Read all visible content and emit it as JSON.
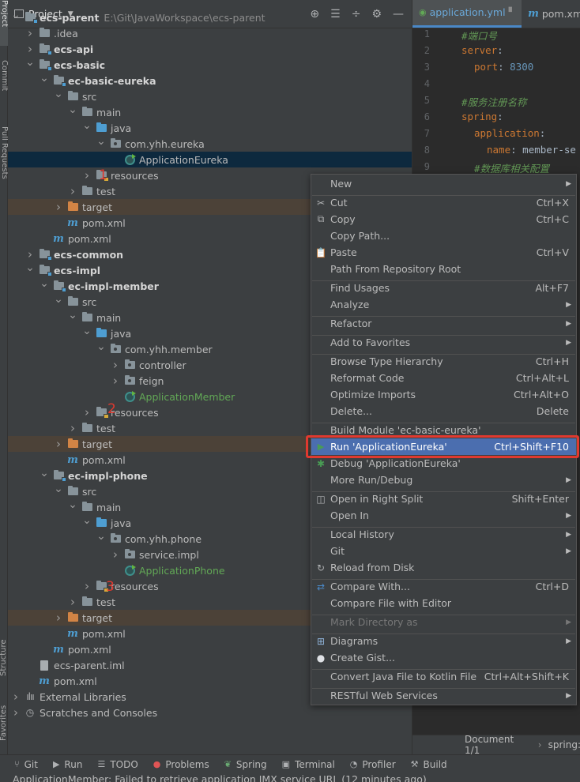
{
  "side_tabs": {
    "project": "Project",
    "commit": "Commit",
    "pull_requests": "Pull Requests",
    "structure": "Structure",
    "favorites": "Favorites"
  },
  "project_panel": {
    "title": "Project",
    "header_icons": [
      "locate-icon",
      "expand-all-icon",
      "collapse-all-icon",
      "gear-icon",
      "hide-icon"
    ],
    "tree": [
      {
        "label": "ecs-parent",
        "path": "E:\\Git\\JavaWorkspace\\ecs-parent",
        "bold": true
      },
      {
        "label": ".idea"
      },
      {
        "label": "ecs-api",
        "bold": true
      },
      {
        "label": "ecs-basic",
        "bold": true
      },
      {
        "label": "ec-basic-eureka",
        "bold": true
      },
      {
        "label": "src"
      },
      {
        "label": "main"
      },
      {
        "label": "java"
      },
      {
        "label": "com.yhh.eureka"
      },
      {
        "label": "ApplicationEureka"
      },
      {
        "label": "resources"
      },
      {
        "label": "test"
      },
      {
        "label": "target"
      },
      {
        "label": "pom.xml"
      },
      {
        "label": "pom.xml"
      },
      {
        "label": "ecs-common",
        "bold": true
      },
      {
        "label": "ecs-impl",
        "bold": true
      },
      {
        "label": "ec-impl-member",
        "bold": true
      },
      {
        "label": "src"
      },
      {
        "label": "main"
      },
      {
        "label": "java"
      },
      {
        "label": "com.yhh.member"
      },
      {
        "label": "controller"
      },
      {
        "label": "feign"
      },
      {
        "label": "ApplicationMember"
      },
      {
        "label": "resources"
      },
      {
        "label": "test"
      },
      {
        "label": "target"
      },
      {
        "label": "pom.xml"
      },
      {
        "label": "ec-impl-phone",
        "bold": true
      },
      {
        "label": "src"
      },
      {
        "label": "main"
      },
      {
        "label": "java"
      },
      {
        "label": "com.yhh.phone"
      },
      {
        "label": "service.impl"
      },
      {
        "label": "ApplicationPhone"
      },
      {
        "label": "resources"
      },
      {
        "label": "test"
      },
      {
        "label": "target"
      },
      {
        "label": "pom.xml"
      },
      {
        "label": "pom.xml"
      },
      {
        "label": "ecs-parent.iml"
      },
      {
        "label": "pom.xml"
      },
      {
        "label": "External Libraries"
      },
      {
        "label": "Scratches and Consoles"
      }
    ],
    "annotations": [
      "1",
      "2",
      "3"
    ]
  },
  "editor": {
    "tabs": [
      "application.yml",
      "pom.xm"
    ],
    "line_numbers": [
      "1",
      "2",
      "3",
      "4",
      "5",
      "6",
      "7",
      "8",
      "9"
    ],
    "lines": [
      {
        "text": "#端口号",
        "type": "comment"
      },
      {
        "key": "server",
        "rest": ":"
      },
      {
        "key": "port",
        "rest": ": ",
        "value": "8300"
      },
      {
        "text": ""
      },
      {
        "text": "#服务注册名称",
        "type": "comment"
      },
      {
        "key": "spring",
        "rest": ":"
      },
      {
        "key": "application",
        "rest": ":"
      },
      {
        "key": "name",
        "rest": ": ",
        "value": "member-se"
      },
      {
        "text": "#数据库相关配置",
        "type": "comment"
      }
    ],
    "breadcrumb": [
      "Document 1/1",
      "spring:"
    ]
  },
  "context_menu": {
    "items": [
      {
        "label": "New",
        "submenu": true
      },
      {
        "label": "Cut",
        "shortcut": "Ctrl+X",
        "icon": "cut-icon"
      },
      {
        "label": "Copy",
        "shortcut": "Ctrl+C",
        "icon": "copy-icon"
      },
      {
        "label": "Copy Path...",
        "shortcut": ""
      },
      {
        "label": "Paste",
        "shortcut": "Ctrl+V",
        "icon": "paste-icon"
      },
      {
        "label": "Path From Repository Root",
        "shortcut": ""
      },
      {
        "label": "Find Usages",
        "shortcut": "Alt+F7"
      },
      {
        "label": "Analyze",
        "submenu": true
      },
      {
        "label": "Refactor",
        "submenu": true
      },
      {
        "label": "Add to Favorites",
        "submenu": true
      },
      {
        "label": "Browse Type Hierarchy",
        "shortcut": "Ctrl+H"
      },
      {
        "label": "Reformat Code",
        "shortcut": "Ctrl+Alt+L"
      },
      {
        "label": "Optimize Imports",
        "shortcut": "Ctrl+Alt+O"
      },
      {
        "label": "Delete...",
        "shortcut": "Delete"
      },
      {
        "label": "Build Module 'ec-basic-eureka'",
        "shortcut": ""
      },
      {
        "label": "Run 'ApplicationEureka'",
        "shortcut": "Ctrl+Shift+F10",
        "icon": "run-icon",
        "highlighted": true
      },
      {
        "label": "Debug 'ApplicationEureka'",
        "shortcut": "",
        "icon": "debug-icon"
      },
      {
        "label": "More Run/Debug",
        "submenu": true
      },
      {
        "label": "Open in Right Split",
        "shortcut": "Shift+Enter",
        "icon": "split-icon"
      },
      {
        "label": "Open In",
        "submenu": true
      },
      {
        "label": "Local History",
        "submenu": true
      },
      {
        "label": "Git",
        "submenu": true
      },
      {
        "label": "Reload from Disk",
        "shortcut": "",
        "icon": "reload-icon"
      },
      {
        "label": "Compare With...",
        "shortcut": "Ctrl+D",
        "icon": "compare-icon"
      },
      {
        "label": "Compare File with Editor",
        "shortcut": ""
      },
      {
        "label": "Mark Directory as",
        "submenu": true,
        "disabled": true
      },
      {
        "label": "Diagrams",
        "submenu": true,
        "icon": "diagram-icon"
      },
      {
        "label": "Create Gist...",
        "shortcut": "",
        "icon": "github-icon"
      },
      {
        "label": "Convert Java File to Kotlin File",
        "shortcut": "Ctrl+Alt+Shift+K"
      },
      {
        "label": "RESTful Web Services",
        "submenu": true
      }
    ]
  },
  "bottom_tools": [
    "Git",
    "Run",
    "TODO",
    "Problems",
    "Spring",
    "Terminal",
    "Profiler",
    "Build"
  ],
  "status_message": "ApplicationMember: Failed to retrieve application JMX service URL (12 minutes ago)",
  "colors": {
    "accent": "#4b6eaf",
    "annotation_red": "#e0392f",
    "run_green": "#499c54",
    "background": "#3c3f41"
  }
}
